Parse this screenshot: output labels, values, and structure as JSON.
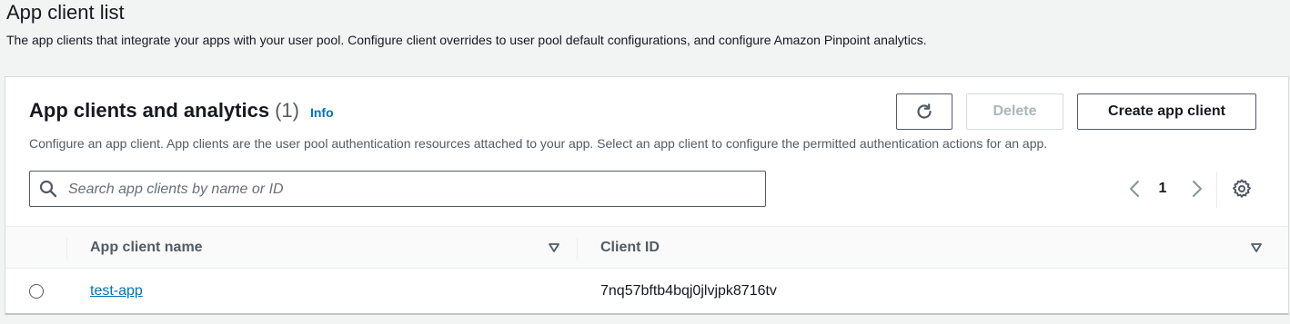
{
  "section": {
    "title": "App client list",
    "description": "The app clients that integrate your apps with your user pool. Configure client overrides to user pool default configurations, and configure Amazon Pinpoint analytics."
  },
  "panel": {
    "title": "App clients and analytics",
    "count": "(1)",
    "info_label": "Info",
    "description": "Configure an app client. App clients are the user pool authentication resources attached to your app. Select an app client to configure the permitted authentication actions for an app.",
    "buttons": {
      "refresh_icon": "refresh-icon",
      "delete_label": "Delete",
      "create_label": "Create app client"
    },
    "search": {
      "placeholder": "Search app clients by name or ID",
      "value": ""
    },
    "pagination": {
      "current_page": "1"
    },
    "table": {
      "columns": [
        "App client name",
        "Client ID"
      ],
      "rows": [
        {
          "name": "test-app",
          "client_id": "7nq57bftb4bqj0jlvjpk8716tv",
          "selected": false
        }
      ]
    }
  },
  "colors": {
    "link": "#0073bb",
    "text": "#16191f",
    "muted": "#545b64",
    "background": "#f2f3f3"
  }
}
